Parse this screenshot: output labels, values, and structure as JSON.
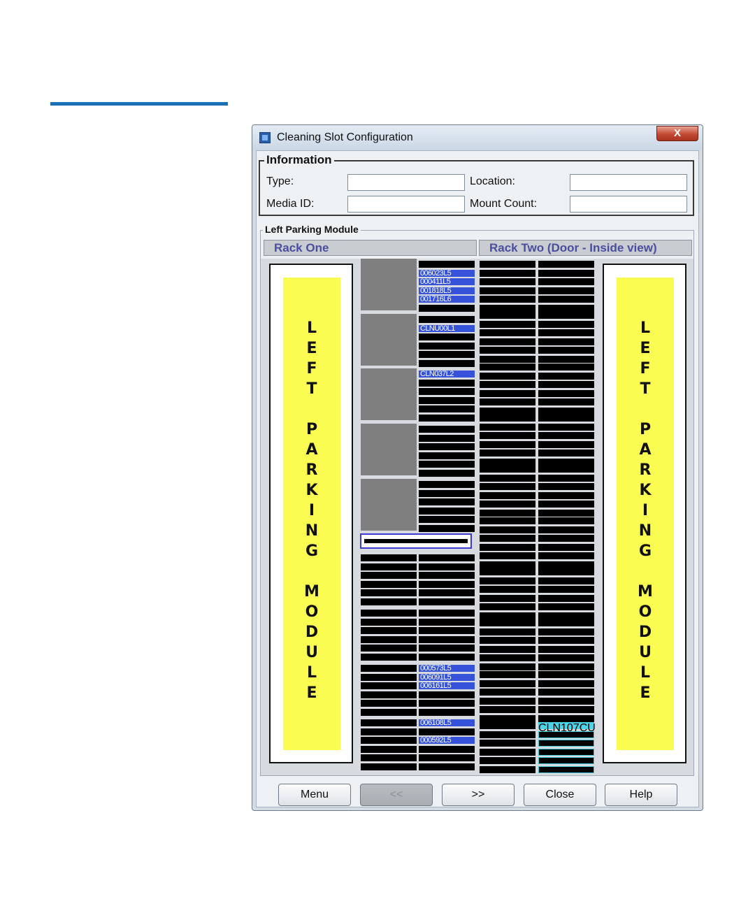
{
  "window": {
    "title": "Cleaning Slot Configuration",
    "close_glyph": "X"
  },
  "information": {
    "legend": "Information",
    "type_label": "Type:",
    "type_value": "",
    "location_label": "Location:",
    "location_value": "",
    "media_id_label": "Media ID:",
    "media_id_value": "",
    "mount_count_label": "Mount Count:",
    "mount_count_value": ""
  },
  "module": {
    "legend": "Left Parking Module",
    "rack_one": "Rack One",
    "rack_two": "Rack Two (Door - Inside view)",
    "side_label": "L\nE\nF\nT\n\nP\nA\nR\nK\nI\nN\nG\n\nM\nO\nD\nU\nL\nE"
  },
  "tapes": {
    "r1_t1": "006023L5",
    "r1_t2": "000411L5",
    "r1_t3": "001818L5",
    "r1_t4": "001716L6",
    "r1_t5": "CLNU00L1",
    "r1_t6": "CLN037L2",
    "r1_t7": "000573L5",
    "r1_t8": "006091L5",
    "r1_t9": "006161L5",
    "r1_t10": "006108L5",
    "r1_t11": "000592L5",
    "r2_t1": "CLN107CU"
  },
  "buttons": {
    "menu": "Menu",
    "prev": "<<",
    "next": ">>",
    "close": "Close",
    "help": "Help"
  }
}
